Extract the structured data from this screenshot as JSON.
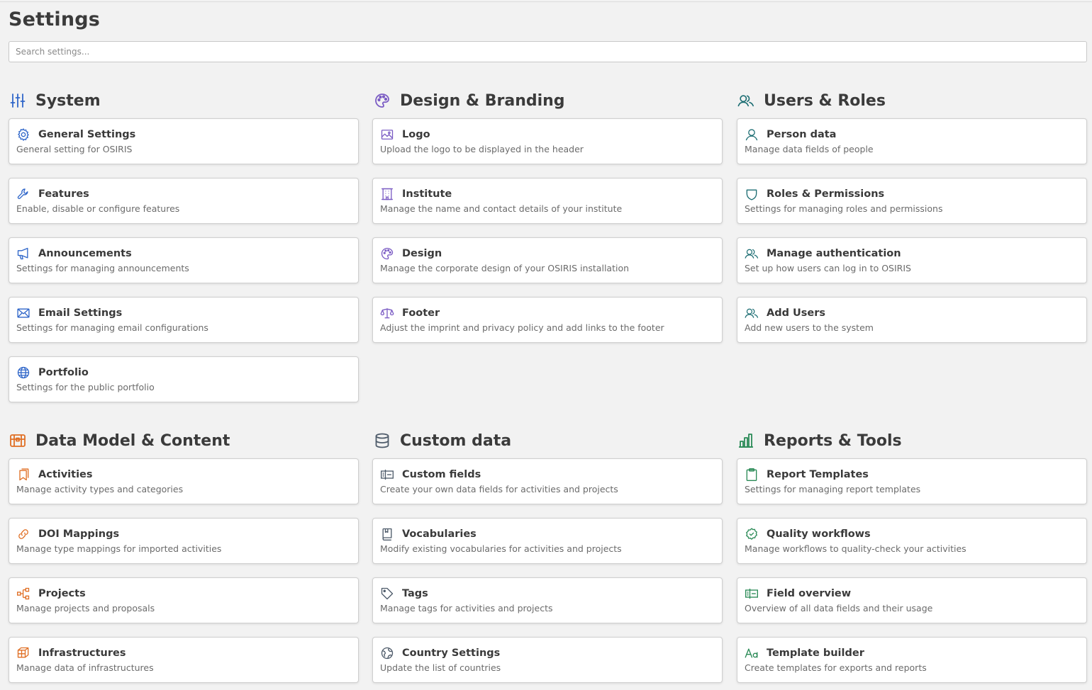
{
  "page": {
    "title": "Settings"
  },
  "search": {
    "placeholder": "Search settings..."
  },
  "sections": {
    "system": {
      "title": "System",
      "icon": "sliders-icon",
      "color": "#2f66c9",
      "items": [
        {
          "title": "General Settings",
          "desc": "General setting for OSIRIS",
          "icon": "gear-icon"
        },
        {
          "title": "Features",
          "desc": "Enable, disable or configure features",
          "icon": "wrench-icon"
        },
        {
          "title": "Announcements",
          "desc": "Settings for managing announcements",
          "icon": "megaphone-icon"
        },
        {
          "title": "Email Settings",
          "desc": "Settings for managing email configurations",
          "icon": "envelope-icon"
        },
        {
          "title": "Portfolio",
          "desc": "Settings for the public portfolio",
          "icon": "globe-icon"
        }
      ]
    },
    "design": {
      "title": "Design & Branding",
      "icon": "palette-icon",
      "color": "#7b5cc4",
      "items": [
        {
          "title": "Logo",
          "desc": "Upload the logo to be displayed in the header",
          "icon": "image-icon"
        },
        {
          "title": "Institute",
          "desc": "Manage the name and contact details of your institute",
          "icon": "building-icon"
        },
        {
          "title": "Design",
          "desc": "Manage the corporate design of your OSIRIS installation",
          "icon": "palette-icon"
        },
        {
          "title": "Footer",
          "desc": "Adjust the imprint and privacy policy and add links to the footer",
          "icon": "scales-icon"
        }
      ]
    },
    "users": {
      "title": "Users & Roles",
      "icon": "users-icon",
      "color": "#1d6e73",
      "items": [
        {
          "title": "Person data",
          "desc": "Manage data fields of people",
          "icon": "user-icon"
        },
        {
          "title": "Roles & Permissions",
          "desc": "Settings for managing roles and permissions",
          "icon": "shield-icon"
        },
        {
          "title": "Manage authentication",
          "desc": "Set up how users can log in to OSIRIS",
          "icon": "users-icon"
        },
        {
          "title": "Add Users",
          "desc": "Add new users to the system",
          "icon": "users-icon"
        }
      ]
    },
    "datamodel": {
      "title": "Data Model & Content",
      "icon": "treasure-chest-icon",
      "color": "#e06f24",
      "items": [
        {
          "title": "Activities",
          "desc": "Manage activity types and categories",
          "icon": "bookmarks-icon"
        },
        {
          "title": "DOI Mappings",
          "desc": "Manage type mappings for imported activities",
          "icon": "link-icon"
        },
        {
          "title": "Projects",
          "desc": "Manage projects and proposals",
          "icon": "tree-structure-icon"
        },
        {
          "title": "Infrastructures",
          "desc": "Manage data of infrastructures",
          "icon": "cube-icon"
        }
      ]
    },
    "custom": {
      "title": "Custom data",
      "icon": "database-icon",
      "color": "#4e5b6a",
      "items": [
        {
          "title": "Custom fields",
          "desc": "Create your own data fields for activities and projects",
          "icon": "textbox-icon"
        },
        {
          "title": "Vocabularies",
          "desc": "Modify existing vocabularies for activities and projects",
          "icon": "book-icon"
        },
        {
          "title": "Tags",
          "desc": "Manage tags for activities and projects",
          "icon": "tag-icon"
        },
        {
          "title": "Country Settings",
          "desc": "Update the list of countries",
          "icon": "globe-hemisphere-icon"
        }
      ]
    },
    "reports": {
      "title": "Reports & Tools",
      "icon": "chart-bar-icon",
      "color": "#2a8a56",
      "items": [
        {
          "title": "Report Templates",
          "desc": "Settings for managing report templates",
          "icon": "clipboard-icon"
        },
        {
          "title": "Quality workflows",
          "desc": "Manage workflows to quality-check your activities",
          "icon": "seal-check-icon"
        },
        {
          "title": "Field overview",
          "desc": "Overview of all data fields and their usage",
          "icon": "textbox-icon"
        },
        {
          "title": "Template builder",
          "desc": "Create templates for exports and reports",
          "icon": "text-aa-icon"
        }
      ]
    }
  }
}
